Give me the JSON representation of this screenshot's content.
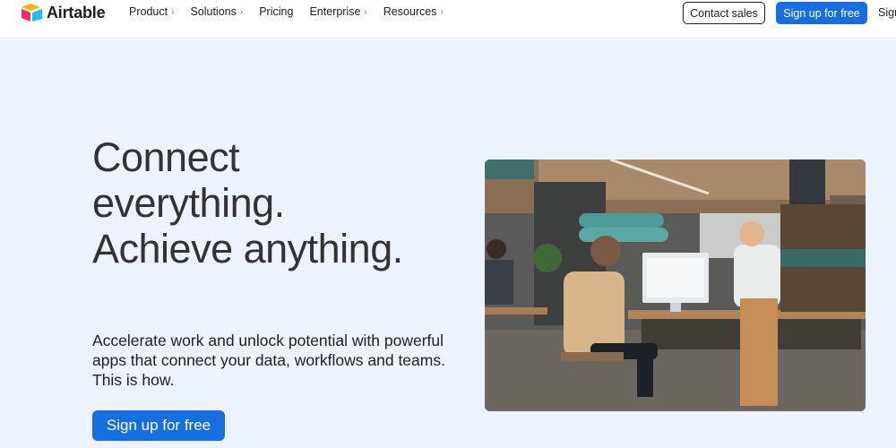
{
  "header": {
    "brand": "Airtable",
    "nav": [
      {
        "label": "Product",
        "chevron": "›"
      },
      {
        "label": "Solutions",
        "chevron": "›"
      },
      {
        "label": "Pricing",
        "chevron": ""
      },
      {
        "label": "Enterprise",
        "chevron": "›"
      },
      {
        "label": "Resources",
        "chevron": "›"
      }
    ],
    "contact_sales": "Contact sales",
    "sign_up": "Sign up for free",
    "sign_in": "Sign in"
  },
  "hero": {
    "headline": "Connect everything. Achieve anything.",
    "subtext": "Accelerate work and unlock potential with powerful apps that connect your data, workflows and teams. This is how.",
    "cta": "Sign up for free",
    "image_icon": "office-team-photo"
  },
  "colors": {
    "accent": "#166ee1",
    "hero_bg": "#edf3fc"
  }
}
